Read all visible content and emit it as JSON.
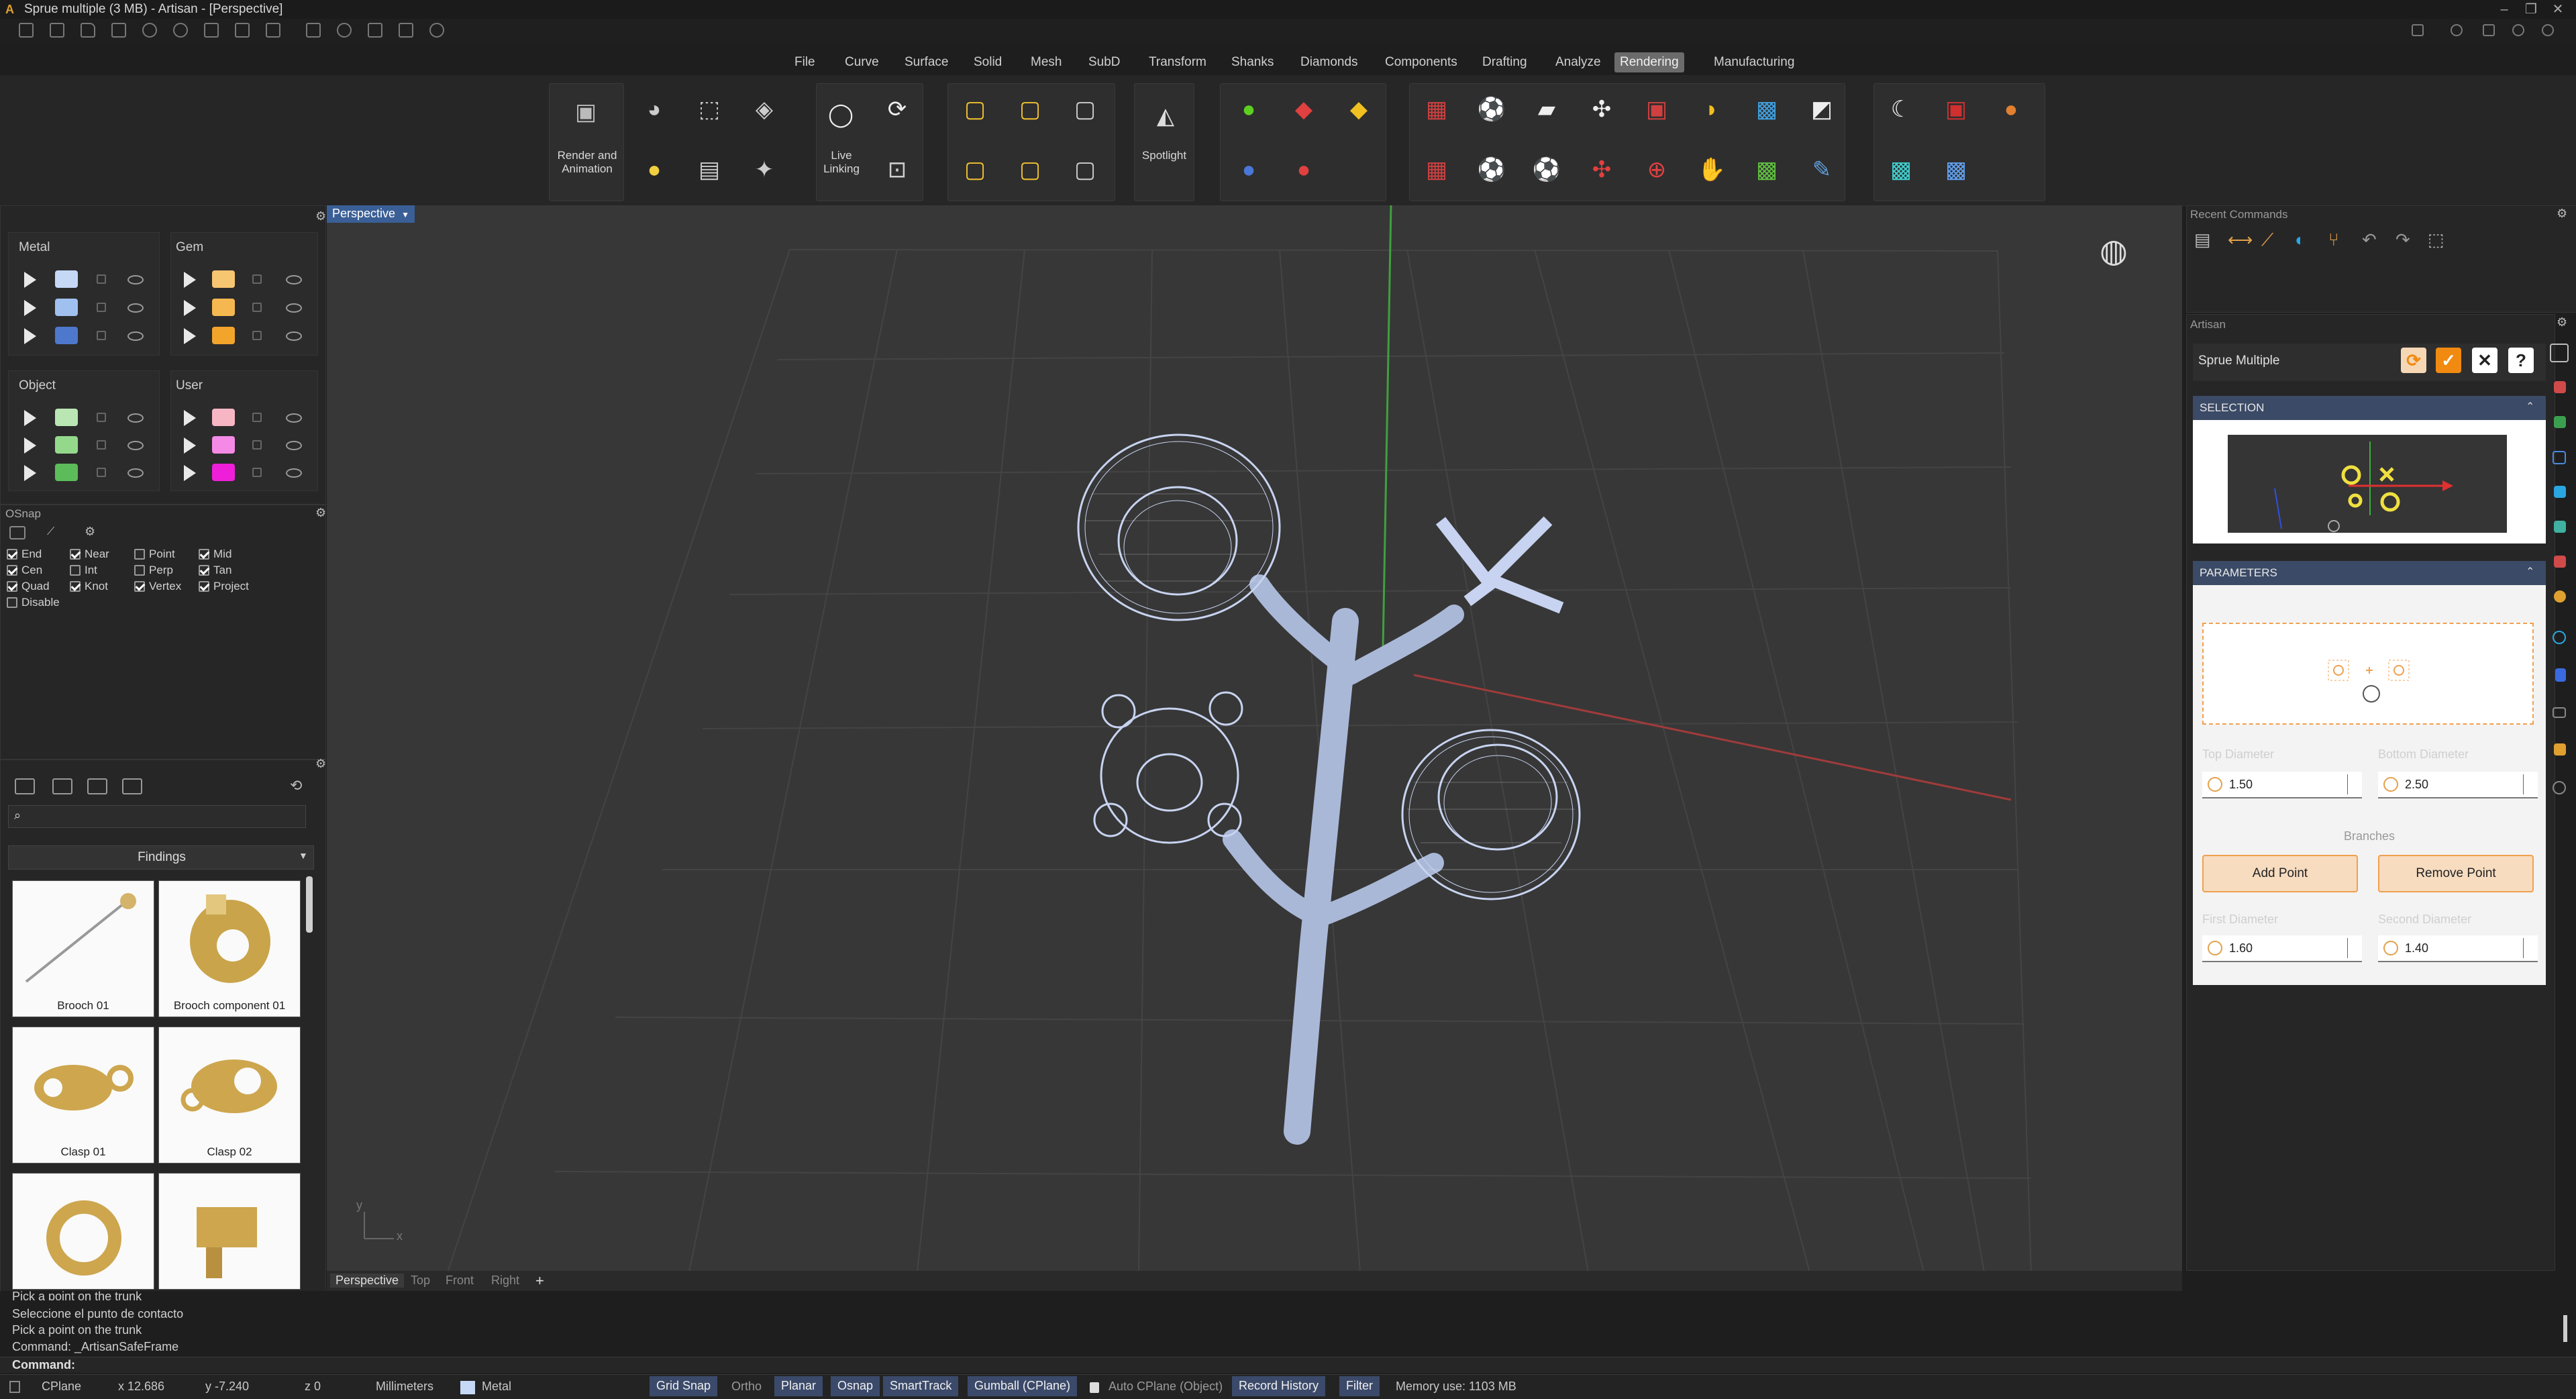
{
  "window": {
    "title": "Sprue multiple (3 MB) - Artisan - [Perspective]"
  },
  "menu": [
    "File",
    "Curve",
    "Surface",
    "Solid",
    "Mesh",
    "SubD",
    "Transform",
    "Shanks",
    "Diamonds",
    "Components",
    "Drafting",
    "Analyze",
    "Rendering",
    "Manufacturing"
  ],
  "menu_active": "Rendering",
  "ribbon": {
    "render_label": "Render and Animation",
    "live_label": "Live Linking",
    "spot_label": "Spotlight"
  },
  "layers": {
    "metal": "Metal",
    "gem": "Gem",
    "object": "Object",
    "user": "User",
    "colors": {
      "metal": [
        "#c5d8f6",
        "#a0c0ef",
        "#4e78cc"
      ],
      "gem": [
        "#f7c670",
        "#f5b850",
        "#f3a42a"
      ],
      "object": [
        "#b9e6b2",
        "#94d98b",
        "#5cbc5a"
      ],
      "user": [
        "#f7b6c4",
        "#f58ae6",
        "#ef1ed9"
      ]
    }
  },
  "osnap": {
    "title": "OSnap",
    "items": [
      {
        "label": "End",
        "on": true
      },
      {
        "label": "Near",
        "on": true
      },
      {
        "label": "Point",
        "on": false
      },
      {
        "label": "Mid",
        "on": true
      },
      {
        "label": "Cen",
        "on": true
      },
      {
        "label": "Int",
        "on": false
      },
      {
        "label": "Perp",
        "on": false
      },
      {
        "label": "Tan",
        "on": true
      },
      {
        "label": "Quad",
        "on": true
      },
      {
        "label": "Knot",
        "on": true
      },
      {
        "label": "Vertex",
        "on": true
      },
      {
        "label": "Project",
        "on": true
      },
      {
        "label": "Disable",
        "on": false
      }
    ]
  },
  "library": {
    "category": "Findings",
    "items": [
      "Brooch 01",
      "Brooch component 01",
      "Clasp 01",
      "Clasp 02",
      "",
      ""
    ]
  },
  "viewport": {
    "label": "Perspective",
    "tabs": [
      "Perspective",
      "Top",
      "Front",
      "Right"
    ],
    "add": "+",
    "axis_x": "x",
    "axis_y": "y"
  },
  "recent": {
    "title": "Recent Commands"
  },
  "artisan": {
    "title": "Artisan",
    "command": "Sprue Multiple",
    "selection": "SELECTION",
    "parameters": "PARAMETERS",
    "top_diameter_label": "Top Diameter",
    "top_diameter": "1.50",
    "bottom_diameter_label": "Bottom Diameter",
    "bottom_diameter": "2.50",
    "branches": "Branches",
    "add_point": "Add Point",
    "remove_point": "Remove Point",
    "first_diameter_label": "First Diameter",
    "first_diameter": "1.60",
    "second_diameter_label": "Second Diameter",
    "second_diameter": "1.40"
  },
  "command_history": [
    "Pick a point on the trunk",
    "Seleccione el punto de contacto",
    "Pick a point on the trunk",
    "Command: _ArtisanSafeFrame"
  ],
  "command_prompt": "Command:",
  "status": {
    "cplane": "CPlane",
    "x": "x 12.686",
    "y": "y -7.240",
    "z": "z 0",
    "units": "Millimeters",
    "layer": "Metal",
    "grid_snap": "Grid Snap",
    "ortho": "Ortho",
    "planar": "Planar",
    "osnap": "Osnap",
    "smarttrack": "SmartTrack",
    "gumball": "Gumball (CPlane)",
    "auto_cplane": "Auto CPlane (Object)",
    "record_history": "Record History",
    "filter": "Filter",
    "memory": "Memory use: 1103 MB"
  }
}
